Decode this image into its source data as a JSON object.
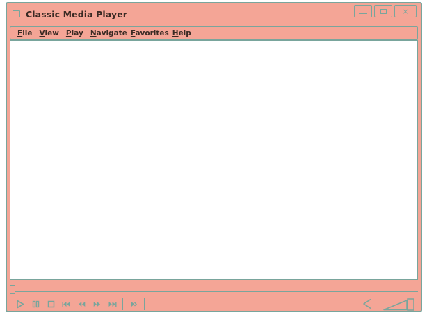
{
  "window": {
    "title": "Classic Media Player",
    "icon": "app-window-icon",
    "controls": {
      "minimize": "minimize-icon",
      "maximize": "maximize-icon",
      "close": "×"
    }
  },
  "menu": {
    "items": [
      {
        "mnemonic": "F",
        "rest": "ile",
        "name": "file"
      },
      {
        "mnemonic": "V",
        "rest": "iew",
        "name": "view"
      },
      {
        "mnemonic": "P",
        "rest": "lay",
        "name": "play"
      },
      {
        "mnemonic": "N",
        "rest": "avigate",
        "name": "navigate"
      },
      {
        "mnemonic": "F",
        "rest": "avorites",
        "name": "favorites"
      },
      {
        "mnemonic": "H",
        "rest": "elp",
        "name": "help"
      }
    ]
  },
  "playback": {
    "position_fraction": 0,
    "buttons": [
      "play-icon",
      "pause-icon",
      "stop-icon",
      "skip-back-icon",
      "rewind-icon",
      "fast-forward-icon",
      "skip-forward-icon",
      "frame-step-icon"
    ]
  },
  "volume": {
    "mute_icon": "speaker-icon",
    "level_fraction": 1.0
  },
  "colors": {
    "chrome": "#f4a596",
    "outline": "#79a59c",
    "text": "#3a2a24",
    "content": "#ffffff"
  }
}
